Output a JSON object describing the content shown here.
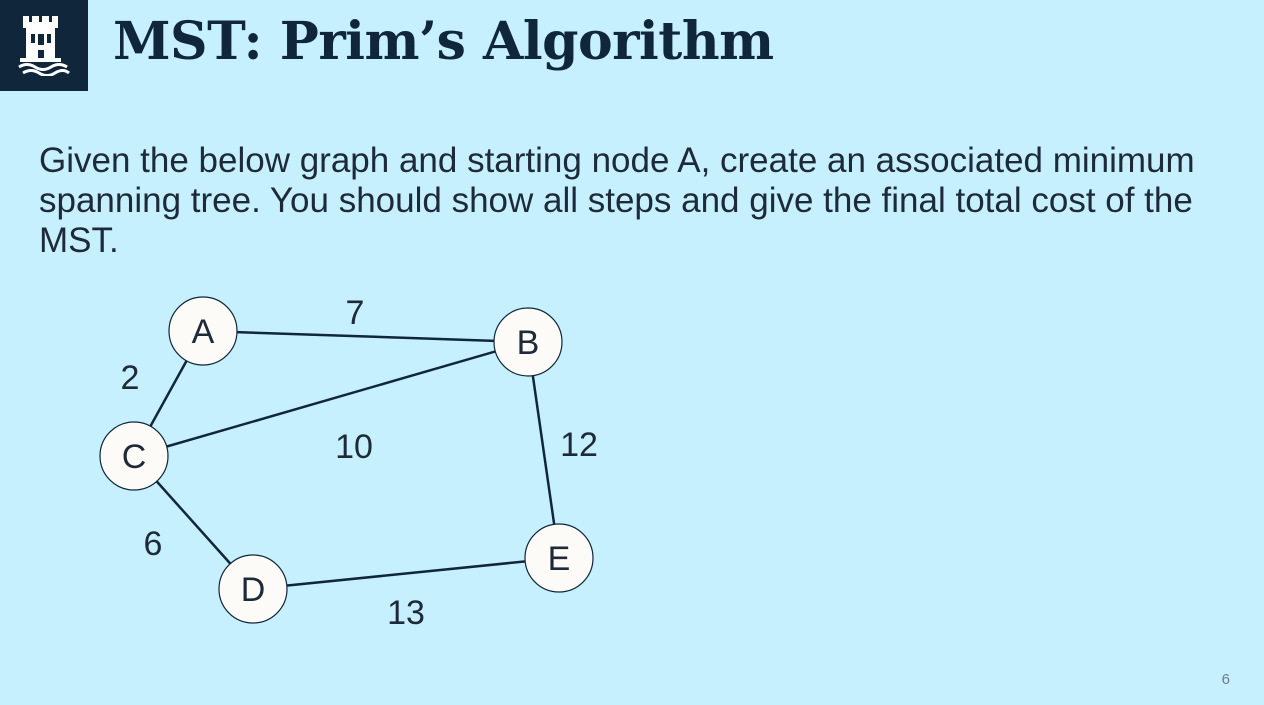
{
  "header": {
    "title": "MST: Prim’s Algorithm",
    "logo_icon": "castle-tower-icon",
    "logo_bg": "#10263b"
  },
  "body": {
    "prompt": "Given the below graph and starting node A, create an associated minimum spanning tree. You should show all steps and give the final total cost of the MST."
  },
  "graph": {
    "nodes": [
      "A",
      "B",
      "C",
      "D",
      "E"
    ],
    "edges": [
      {
        "from": "A",
        "to": "B",
        "weight": "7"
      },
      {
        "from": "A",
        "to": "C",
        "weight": "2"
      },
      {
        "from": "C",
        "to": "B",
        "weight": "10"
      },
      {
        "from": "B",
        "to": "E",
        "weight": "12"
      },
      {
        "from": "C",
        "to": "D",
        "weight": "6"
      },
      {
        "from": "D",
        "to": "E",
        "weight": "13"
      }
    ]
  },
  "footer": {
    "page_number": "6"
  },
  "colors": {
    "background": "#c6f0fe",
    "accent": "#10263b",
    "node_fill": "#fdfbf7"
  }
}
